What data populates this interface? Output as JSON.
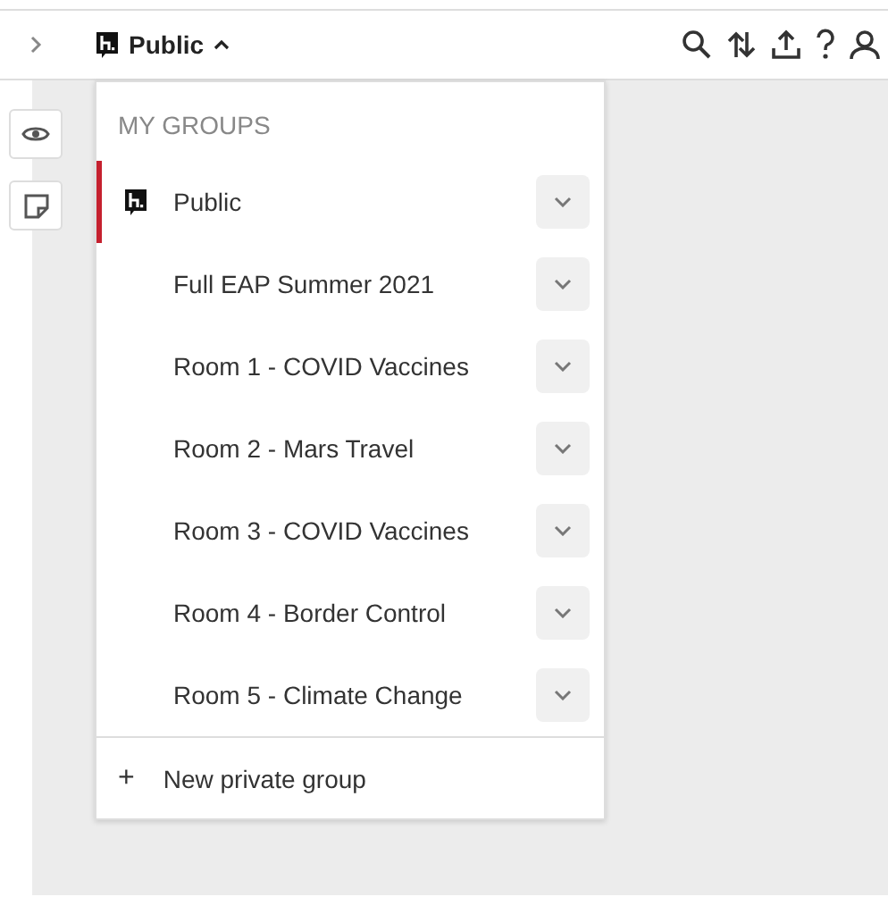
{
  "top_bar": {
    "group_name": "Public",
    "menu_open": true
  },
  "dropdown": {
    "heading": "MY GROUPS",
    "groups": [
      {
        "name": "Public",
        "selected": true,
        "has_logo": true
      },
      {
        "name": "Full EAP Summer 2021",
        "selected": false,
        "has_logo": false
      },
      {
        "name": "Room 1 - COVID Vaccines",
        "selected": false,
        "has_logo": false
      },
      {
        "name": "Room 2 - Mars Travel",
        "selected": false,
        "has_logo": false
      },
      {
        "name": "Room 3 - COVID Vaccines",
        "selected": false,
        "has_logo": false
      },
      {
        "name": "Room 4 - Border Control",
        "selected": false,
        "has_logo": false
      },
      {
        "name": "Room 5 - Climate Change",
        "selected": false,
        "has_logo": false
      }
    ],
    "new_group": {
      "icon": "+",
      "label": "New private group"
    }
  }
}
